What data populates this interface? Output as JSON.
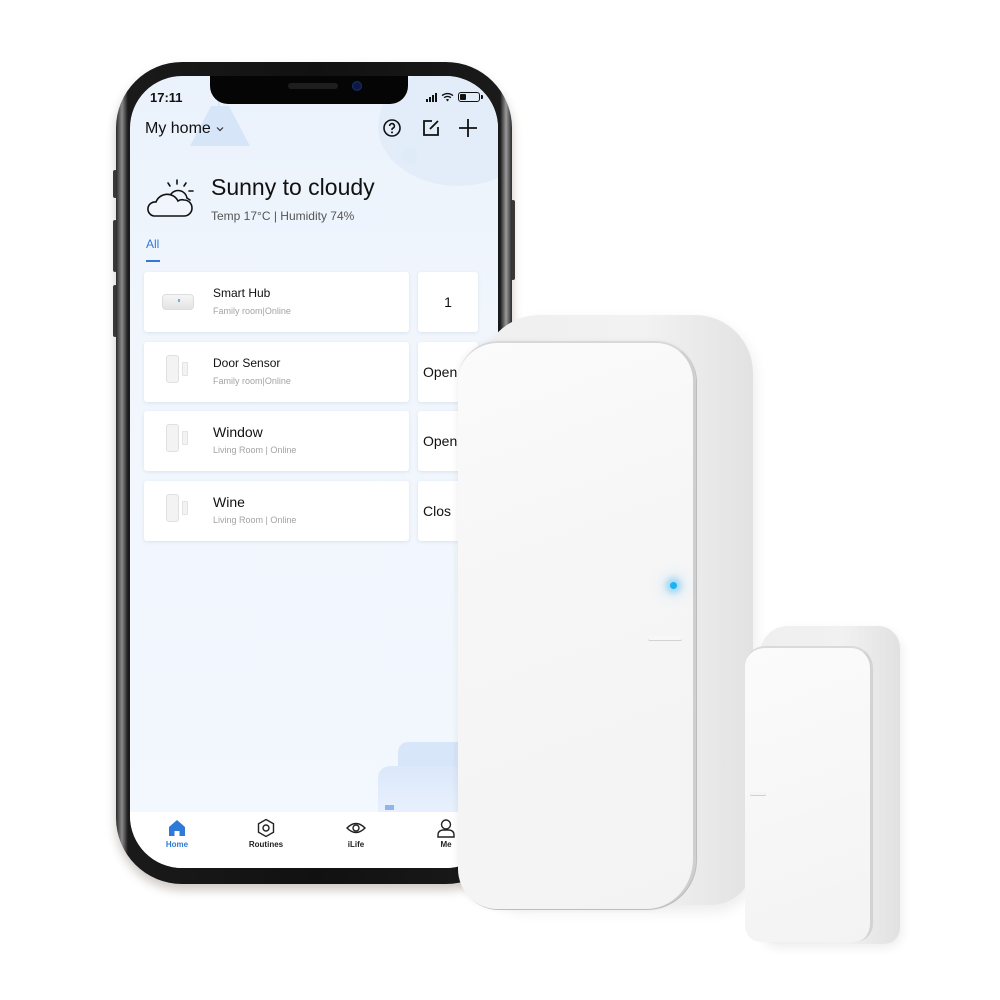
{
  "status_bar": {
    "time": "17:11",
    "battery_level": 0.35,
    "icons": [
      "signal-icon",
      "wifi-icon",
      "battery-icon"
    ]
  },
  "header": {
    "home_label": "My home",
    "icons": [
      "chevron-down-icon",
      "help-icon",
      "edit-icon",
      "add-icon"
    ]
  },
  "weather": {
    "icon": "partly-cloudy-icon",
    "title": "Sunny to cloudy",
    "details": "Temp 17°C | Humidity 74%"
  },
  "tabs": {
    "active": "All"
  },
  "devices": [
    {
      "name": "Smart Hub",
      "location": "Family room|Online",
      "status": "1",
      "thumb": "hub"
    },
    {
      "name": "Door Sensor",
      "location": "Family room|Online",
      "status": "Open",
      "thumb": "sensor"
    },
    {
      "name": "Window",
      "location": "Living Room | Online",
      "status": "Open",
      "thumb": "sensor"
    },
    {
      "name": "Wine",
      "location": "Living Room | Online",
      "status": "Clos",
      "thumb": "sensor"
    }
  ],
  "tabbar": [
    {
      "label": "Home",
      "icon": "home-icon",
      "active": true
    },
    {
      "label": "Routines",
      "icon": "hexagon-icon",
      "active": false
    },
    {
      "label": "iLife",
      "icon": "eye-icon",
      "active": false
    },
    {
      "label": "Me",
      "icon": "person-icon",
      "active": false
    }
  ],
  "colors": {
    "accent": "#2f7ad9",
    "led": "#18b4f0",
    "screen_bg": "#f1f6fd"
  }
}
